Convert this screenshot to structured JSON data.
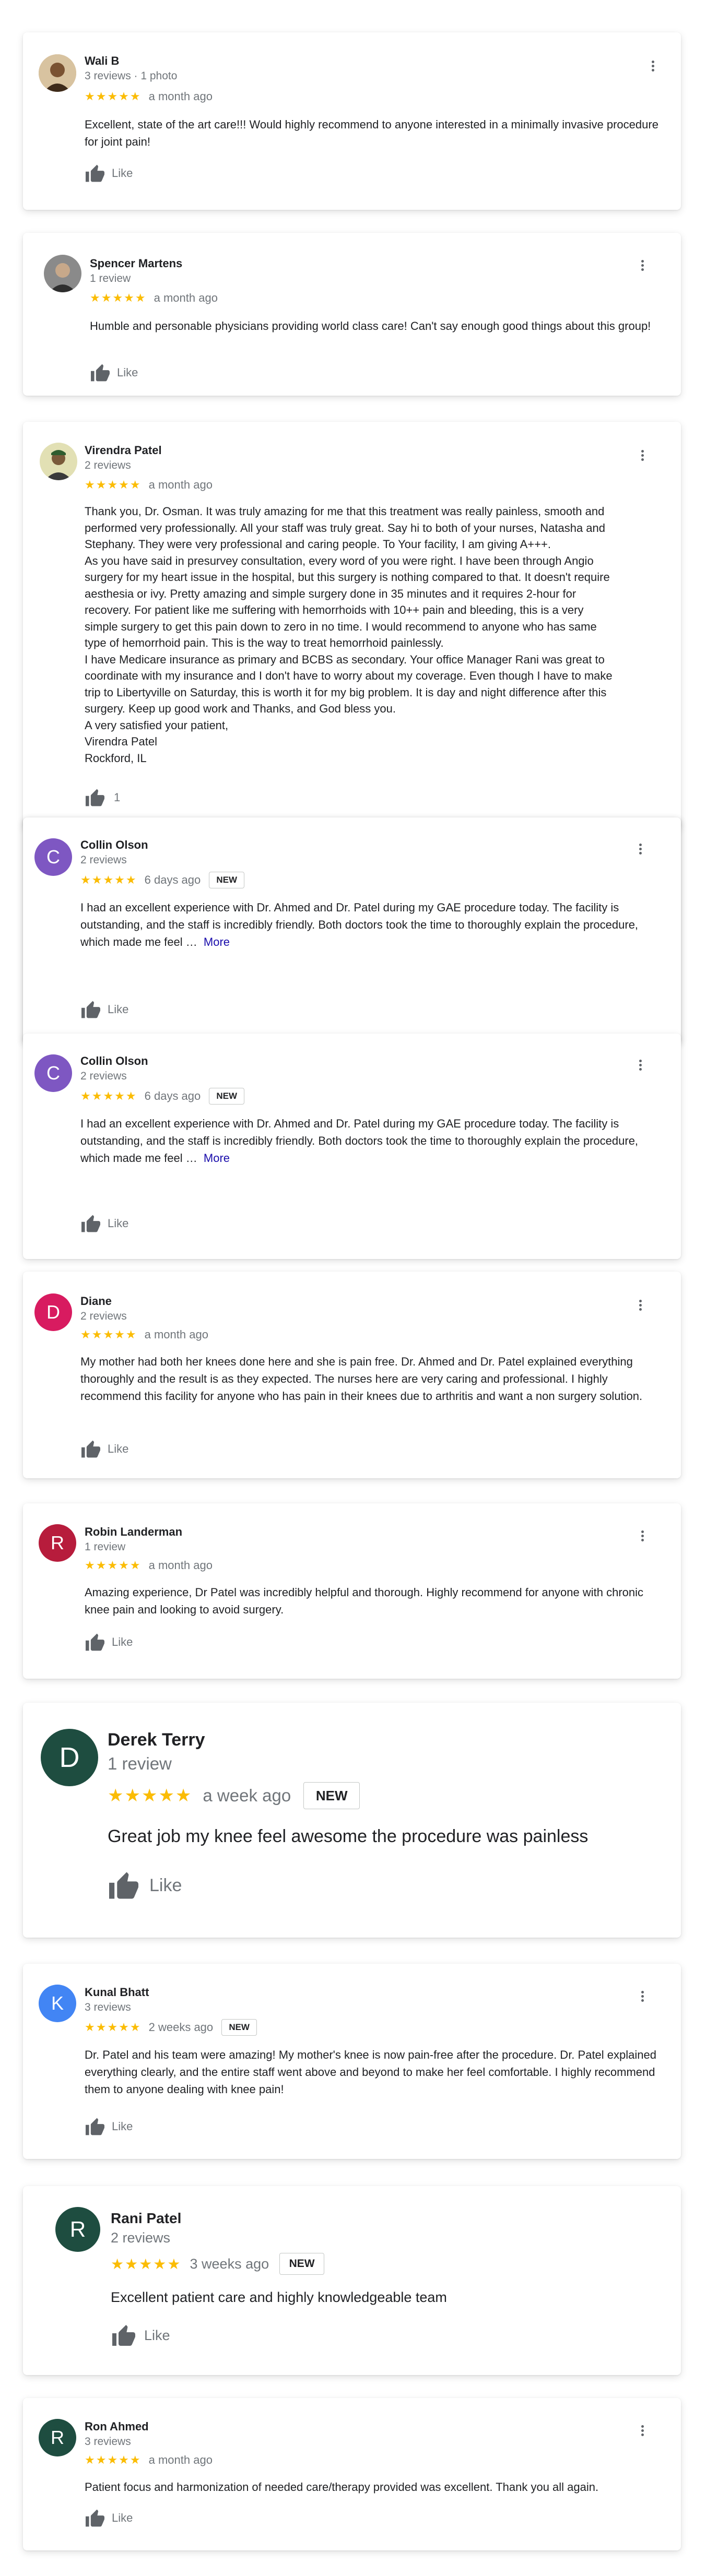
{
  "reviews": [
    {
      "name": "Wali B",
      "meta": "3 reviews · 1 photo",
      "stars": "★★★★★",
      "ago": "a month ago",
      "text": "Excellent, state of the art care!!! Would highly recommend to anyone interested in a minimally invasive procedure for joint pain!",
      "like": "Like",
      "avatar": {
        "letter": "",
        "icon": "photo-avatar",
        "color": "#8d6e4f"
      }
    },
    {
      "name": "Spencer Martens",
      "meta": "1 review",
      "stars": "★★★★★",
      "ago": "a month ago",
      "text": "Humble and personable physicians providing world class care! Can't say enough good things about this group!",
      "like": "Like",
      "avatar": {
        "letter": "",
        "icon": "photo-avatar",
        "color": "#4a4a4a"
      }
    },
    {
      "name": "Virendra Patel",
      "meta": "2 reviews",
      "stars": "★★★★★",
      "ago": "a month ago",
      "text_lines": [
        "Thank you, Dr. Osman. It was truly amazing for me that this treatment was really painless, smooth and",
        "performed very professionally. All your staff was truly great. Say hi to both of your nurses, Natasha and",
        "Stephany. They were very professional and caring people. To Your facility, I am giving A+++.",
        "As you have said in presurvey consultation, every word of you were right. I have been through Angio",
        "surgery for my heart issue in the hospital, but this surgery is nothing compared to that. It doesn't require",
        "aesthesia or ivy. Pretty amazing and simple surgery done in 35 minutes and it requires 2-hour for",
        "recovery. For patient like me suffering with hemorrhoids with 10++ pain and bleeding, this is a very",
        "simple surgery to get this pain down to zero in no time. I would recommend to anyone who has same",
        "type of hemorrhoid pain. This is the way to treat hemorrhoid painlessly.",
        "I have Medicare insurance as primary and BCBS as secondary. Your office Manager Rani was great to",
        "coordinate with my insurance and I don't have to worry about my coverage. Even though I have to make",
        "trip to Libertyville on Saturday, this is worth it for my big problem. It is day and night difference after this",
        "surgery. Keep up good work and Thanks, and God bless you.",
        "A very satisfied your patient,",
        "Virendra Patel",
        "Rockford, IL"
      ],
      "like": "1",
      "avatar": {
        "letter": "",
        "icon": "photo-avatar",
        "color": "#6b7a3a"
      }
    },
    {
      "name": "Collin Olson",
      "meta": "2 reviews",
      "stars": "★★★★★",
      "ago": "6 days ago",
      "badge": "NEW",
      "text": "I had an excellent experience with Dr. Ahmed and Dr. Patel during my GAE procedure today. The facility is outstanding, and the staff is incredibly friendly. Both doctors took the time to thoroughly explain the procedure, which made me feel …",
      "more": "More",
      "like": "Like",
      "avatar": {
        "letter": "C",
        "color": "#7e57c2"
      }
    },
    {
      "name": "Collin Olson",
      "meta": "2 reviews",
      "stars": "★★★★★",
      "ago": "6 days ago",
      "badge": "NEW",
      "text": "I had an excellent experience with Dr. Ahmed and Dr. Patel during my GAE procedure today. The facility is outstanding, and the staff is incredibly friendly. Both doctors took the time to thoroughly explain the procedure, which made me feel …",
      "more": "More",
      "like": "Like",
      "avatar": {
        "letter": "C",
        "color": "#7e57c2"
      }
    },
    {
      "name": "Diane",
      "meta": "2 reviews",
      "stars": "★★★★★",
      "ago": "a month ago",
      "text": "My mother had both her knees done here and she is pain free. Dr. Ahmed and Dr. Patel explained everything thoroughly and the result is as they expected. The nurses here are very caring and professional. I highly recommend this facility for anyone who has pain in their knees due to arthritis and want a non surgery solution.",
      "like": "Like",
      "avatar": {
        "letter": "D",
        "color": "#d81b60"
      }
    },
    {
      "name": "Robin Landerman",
      "meta": "1 review",
      "stars": "★★★★★",
      "ago": "a month ago",
      "text": "Amazing experience, Dr Patel was incredibly helpful and thorough. Highly recommend for anyone with chronic knee pain and looking to avoid surgery.",
      "like": "Like",
      "avatar": {
        "letter": "R",
        "color": "#b71c3c"
      }
    },
    {
      "name": "Derek Terry",
      "meta": "1 review",
      "stars": "★★★★★",
      "ago": "a week ago",
      "badge": "NEW",
      "text": "Great job my knee feel awesome the procedure was painless",
      "like": "Like",
      "avatar": {
        "letter": "D",
        "color": "#1e4d40"
      }
    },
    {
      "name": "Kunal Bhatt",
      "meta": "3 reviews",
      "stars": "★★★★★",
      "ago": "2 weeks ago",
      "badge": "NEW",
      "text": "Dr. Patel and his team were amazing! My mother's knee is now pain-free after the procedure. Dr. Patel explained everything clearly, and the entire staff went above and beyond to make her feel comfortable. I highly recommend them to anyone dealing with knee pain!",
      "like": "Like",
      "avatar": {
        "letter": "K",
        "color": "#4285f4"
      }
    },
    {
      "name": "Rani Patel",
      "meta": "2 reviews",
      "stars": "★★★★★",
      "ago": "3 weeks ago",
      "badge": "NEW",
      "text": "Excellent patient care and highly knowledgeable team",
      "like": "Like",
      "avatar": {
        "letter": "R",
        "color": "#1e4d40"
      }
    },
    {
      "name": "Ron Ahmed",
      "meta": "3 reviews",
      "stars": "★★★★★",
      "ago": "a month ago",
      "text": "Patient focus and harmonization of needed care/therapy provided was excellent. Thank you all again.",
      "like": "Like",
      "avatar": {
        "letter": "R",
        "color": "#1e4d40"
      }
    }
  ]
}
